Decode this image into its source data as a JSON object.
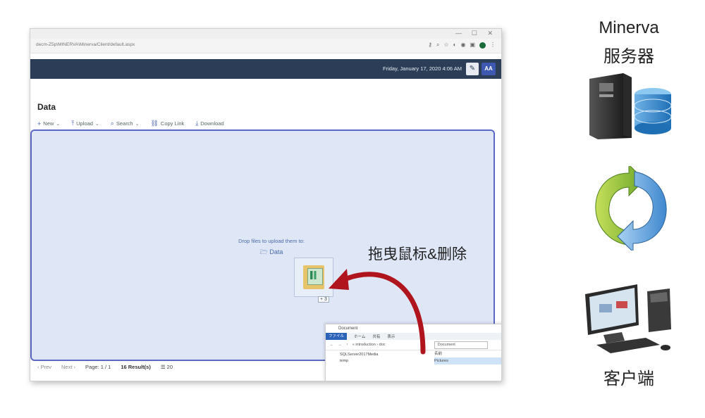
{
  "browser": {
    "url": "decm-Z5p\\MINERVA\\Minerva/Client/default.aspx",
    "profile_initial": "C"
  },
  "app": {
    "datetime": "Friday, January 17, 2020 4:06 AM",
    "user_initials": "AA"
  },
  "page": {
    "title": "Data",
    "toolbar": [
      {
        "label": "New",
        "icon": "plus-icon",
        "dropdown": true
      },
      {
        "label": "Upload",
        "icon": "upload-icon",
        "dropdown": true
      },
      {
        "label": "Search",
        "icon": "search-icon",
        "dropdown": true
      },
      {
        "label": "Copy Link",
        "icon": "link-icon",
        "dropdown": false
      },
      {
        "label": "Download",
        "icon": "download-icon",
        "dropdown": false
      }
    ],
    "dropzone": {
      "hint": "Drop files to upload them to:",
      "folder": "Data"
    },
    "drag_badge": "+ 3",
    "pager": {
      "prev": "Prev",
      "next": "Next",
      "page": "Page: 1 / 1",
      "results": "16 Result(s)",
      "per_page": "20"
    }
  },
  "explorer": {
    "title": "Document",
    "ribbon": [
      "ファイル",
      "ホーム",
      "共有",
      "表示"
    ],
    "breadcrumb": "« introduction › doc",
    "location": "Document",
    "left_items": [
      "SQLServer2017Media",
      "temp"
    ],
    "right_items": [
      "名前",
      "Pictures"
    ]
  },
  "caption": "拖曳鼠标&删除",
  "labels": {
    "server_line1": "Minerva",
    "server_line2": "服务器",
    "client": "客户端"
  },
  "colors": {
    "appbar": "#2c3e57",
    "dropzone_bg": "#dfe7f7",
    "dropzone_border": "#5a68c4",
    "arrow": "#b0151d"
  }
}
